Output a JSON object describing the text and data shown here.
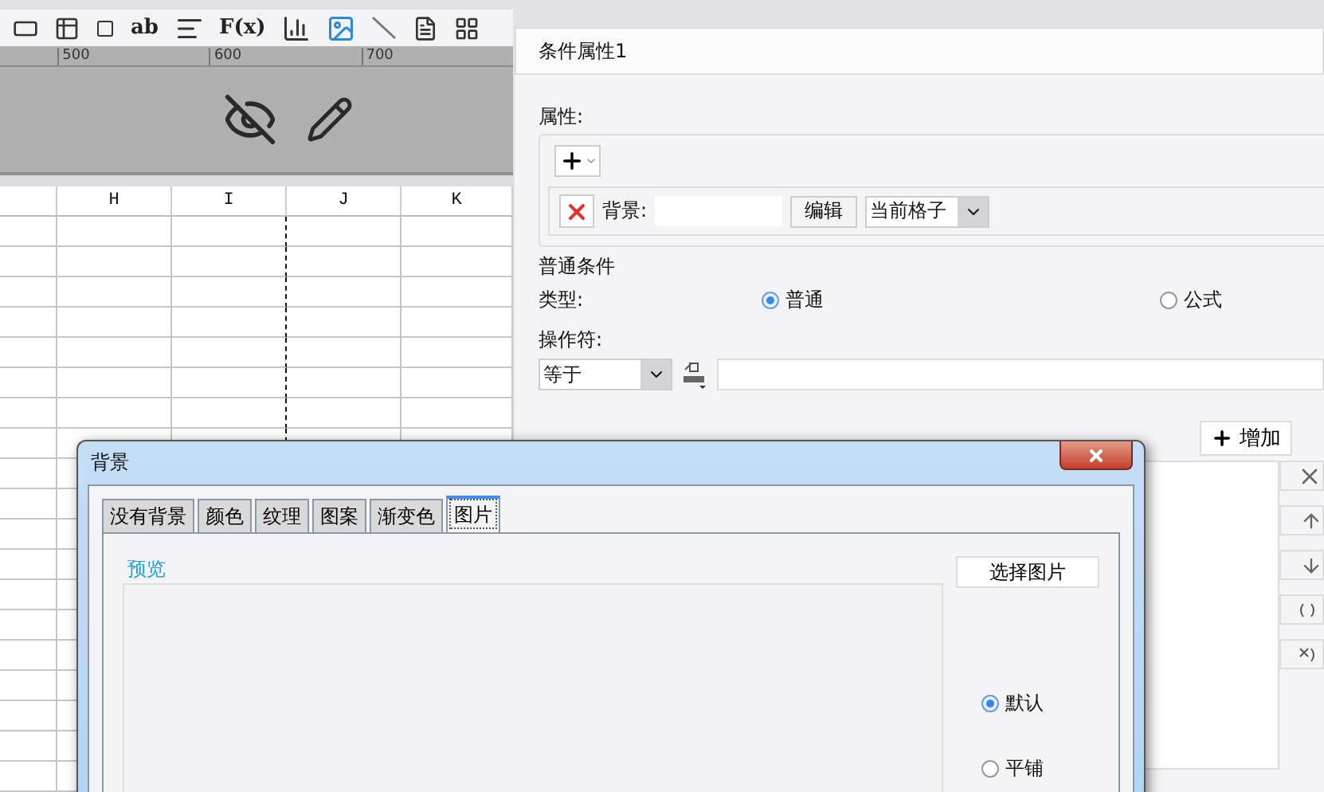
{
  "toolbar": {
    "text_buttons": [
      "ab",
      "F(x)"
    ]
  },
  "ruler": {
    "ticks": [
      "500",
      "600",
      "700"
    ]
  },
  "sheet": {
    "columns": [
      "H",
      "I",
      "J",
      "K"
    ]
  },
  "panel": {
    "title": "条件属性1",
    "properties_label": "属性:",
    "property_row": {
      "label": "背景:",
      "edit_button": "编辑",
      "scope": "当前格子"
    },
    "normal_condition": {
      "title": "普通条件",
      "type_label": "类型:",
      "type_options": [
        {
          "label": "普通",
          "selected": true
        },
        {
          "label": "公式",
          "selected": false
        }
      ],
      "operator_label": "操作符:",
      "operator": "等于"
    },
    "add_button": "增加"
  },
  "dialog": {
    "title": "背景",
    "tabs": [
      {
        "label": "没有背景",
        "selected": false
      },
      {
        "label": "颜色",
        "selected": false
      },
      {
        "label": "纹理",
        "selected": false
      },
      {
        "label": "图案",
        "selected": false
      },
      {
        "label": "渐变色",
        "selected": false
      },
      {
        "label": "图片",
        "selected": true
      }
    ],
    "preview_label": "预览",
    "choose_button": "选择图片",
    "fill_options": [
      {
        "label": "默认",
        "selected": true
      },
      {
        "label": "平铺",
        "selected": false
      }
    ]
  }
}
